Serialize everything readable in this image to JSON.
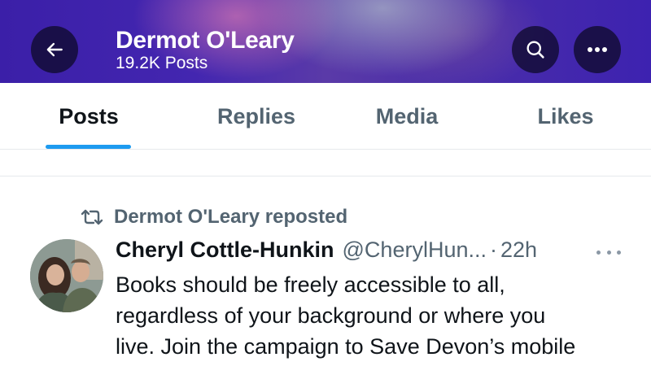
{
  "header": {
    "title": "Dermot O'Leary",
    "subtitle": "19.2K Posts",
    "back_icon": "arrow-left-icon",
    "search_icon": "search-icon",
    "more_icon": "more-horizontal-icon"
  },
  "tabs": [
    {
      "label": "Posts",
      "active": true
    },
    {
      "label": "Replies",
      "active": false
    },
    {
      "label": "Media",
      "active": false
    },
    {
      "label": "Likes",
      "active": false
    }
  ],
  "feed": {
    "repost": {
      "icon": "repost-icon",
      "text": "Dermot O'Leary reposted"
    },
    "post": {
      "author_name": "Cheryl Cottle-Hunkin",
      "handle": "@CherylHun...",
      "separator": "·",
      "time": "22h",
      "lines": [
        "Books should be freely accessible to all,",
        "regardless of your background or where you",
        "live. Join the campaign to Save Devon’s mobile"
      ]
    }
  },
  "colors": {
    "accent": "#1d9bf0",
    "text_primary": "#0f1419",
    "text_secondary": "#536471",
    "header_purple": "#4326b0"
  }
}
